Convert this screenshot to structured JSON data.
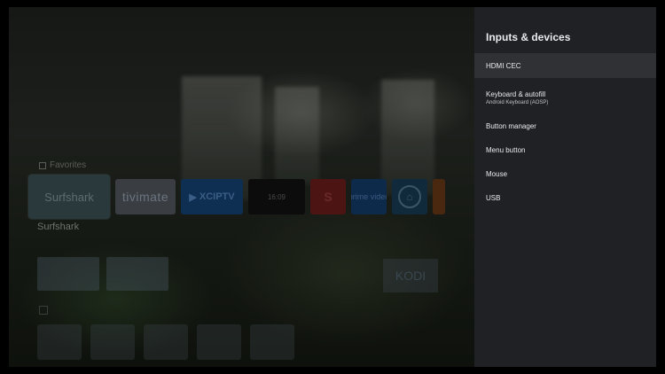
{
  "background": {
    "favorites_label": "Favorites",
    "focused_app_label": "Surfshark",
    "apps": [
      {
        "name": "Surfshark",
        "text": "Surfshark"
      },
      {
        "name": "TiviMate",
        "text": "tivimate"
      },
      {
        "name": "XCIPTV",
        "text": "XCIPTV"
      },
      {
        "name": "Clock",
        "text": "16:09"
      },
      {
        "name": "S app",
        "text": "S"
      },
      {
        "name": "Prime Video",
        "text": "prime video"
      },
      {
        "name": "Home"
      },
      {
        "name": "Orange app"
      }
    ],
    "kodi_text": "KODI"
  },
  "panel": {
    "title": "Inputs & devices",
    "items": [
      {
        "label": "HDMI CEC",
        "focused": true
      },
      {
        "label": "Keyboard & autofill",
        "sublabel": "Android Keyboard (AOSP)"
      },
      {
        "label": "Button manager"
      },
      {
        "label": "Menu button"
      },
      {
        "label": "Mouse"
      },
      {
        "label": "USB"
      }
    ]
  },
  "colors": {
    "panel_bg": "#202124",
    "focused_item_bg": "#303134",
    "text_primary": "#e8eaed",
    "text_secondary": "#bdc1c6"
  }
}
